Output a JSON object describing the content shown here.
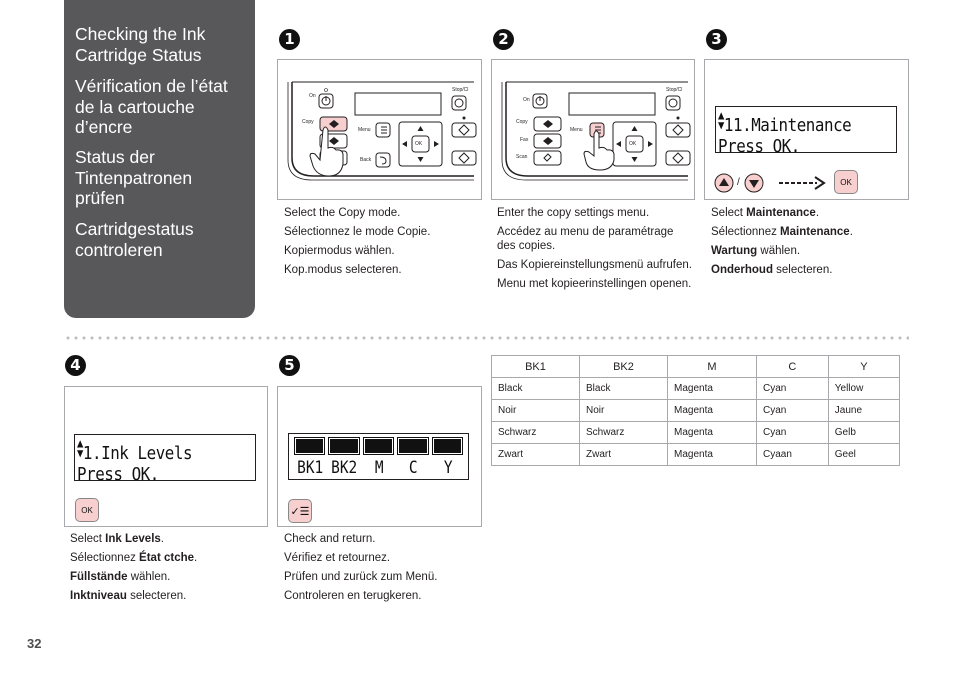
{
  "sidebar": {
    "titles": [
      "Checking the Ink Cartridge Status",
      "Vérification de l’état de la cartouche d’encre",
      "Status der Tintenpatronen prüfen",
      "Cartridgestatus controleren"
    ],
    "lines": [
      [
        "Checking the Ink",
        "Cartridge Status"
      ],
      [
        "Vérification de l’état",
        "de la cartouche",
        "d’encre"
      ],
      [
        "Status der",
        "Tintenpatronen",
        "prüfen"
      ],
      [
        "Cartridgestatus",
        "controleren"
      ]
    ]
  },
  "panel_labels": {
    "on": "On",
    "copy": "Copy",
    "fax": "Fax",
    "scan": "Scan",
    "menu": "Menu",
    "back": "Back",
    "ok": "OK",
    "stop": "Stop/Cl"
  },
  "steps": [
    {
      "number": "1",
      "text": [
        "Select the Copy mode.",
        "Sélectionnez le mode Copie.",
        "Kopiermodus wählen.",
        "Kop.modus selecteren."
      ]
    },
    {
      "number": "2",
      "text": [
        "Enter the copy settings menu.",
        "Accédez au menu de paramétrage des copies.",
        "Das Kopiereinstellungsmenü aufrufen.",
        "Menu met kopieerinstellingen openen."
      ]
    },
    {
      "number": "3",
      "lcd": [
        "11.Maintenance",
        "Press OK."
      ],
      "button_ok": "OK",
      "slash": "/",
      "text_parts": [
        {
          "pre": "Select ",
          "bold": "Maintenance",
          "post": "."
        },
        {
          "pre": "Sélectionnez ",
          "bold": "Maintenance",
          "post": "."
        },
        {
          "pre": "",
          "bold": "Wartung",
          "post": " wählen."
        },
        {
          "pre": "",
          "bold": "Onderhoud",
          "post": " selecteren."
        }
      ]
    },
    {
      "number": "4",
      "lcd": [
        "1.Ink Levels",
        "Press OK."
      ],
      "button_ok": "OK",
      "text_parts": [
        {
          "pre": "Select ",
          "bold": "Ink Levels",
          "post": "."
        },
        {
          "pre": "Sélectionnez ",
          "bold": "État ctche",
          "post": "."
        },
        {
          "pre": "",
          "bold": "Füllstände",
          "post": " wählen."
        },
        {
          "pre": "",
          "bold": "Inktniveau",
          "post": " selecteren."
        }
      ]
    },
    {
      "number": "5",
      "lcd_labels": [
        "BK1",
        "BK2",
        "M",
        "C",
        "Y"
      ],
      "ink_levels_percent": [
        100,
        100,
        100,
        100,
        100
      ],
      "text": [
        "Check and return.",
        "Vérifiez et retournez.",
        "Prüfen und zurück zum Menü.",
        "Controleren en terugkeren."
      ]
    }
  ],
  "ink_table": {
    "headers": [
      "BK1",
      "BK2",
      "M",
      "C",
      "Y"
    ],
    "rows": [
      [
        "Black",
        "Black",
        "Magenta",
        "Cyan",
        "Yellow"
      ],
      [
        "Noir",
        "Noir",
        "Magenta",
        "Cyan",
        "Jaune"
      ],
      [
        "Schwarz",
        "Schwarz",
        "Magenta",
        "Cyan",
        "Gelb"
      ],
      [
        "Zwart",
        "Zwart",
        "Magenta",
        "Cyaan",
        "Geel"
      ]
    ]
  },
  "page_number": "32",
  "colors": {
    "sidebar_bg": "#58585a",
    "highlight_button": "#f8cfcf",
    "frame_border": "#a7a9ac"
  }
}
